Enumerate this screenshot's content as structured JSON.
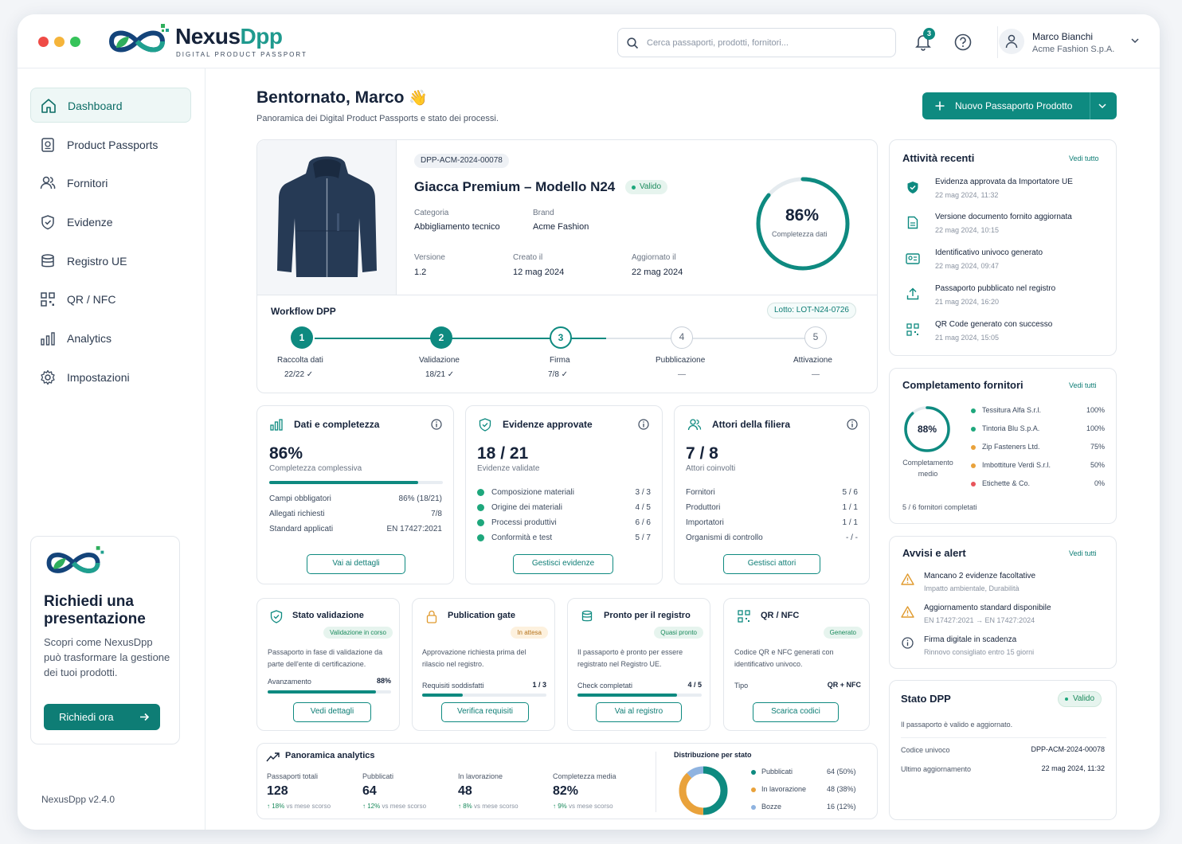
{
  "app": {
    "brand_a": "Nexus",
    "brand_b": "Dpp",
    "brand_sub": "DIGITAL PRODUCT PASSPORT",
    "version": "NexusDpp v2.4.0"
  },
  "topbar": {
    "search_placeholder": "Cerca passaporti, prodotti, fornitori...",
    "notification_count": "3",
    "user_name": "Marco Bianchi",
    "user_company": "Acme Fashion S.p.A."
  },
  "sidebar": {
    "items": [
      {
        "label": "Dashboard",
        "icon": "home-icon"
      },
      {
        "label": "Product Passports",
        "icon": "passport-icon"
      },
      {
        "label": "Fornitori",
        "icon": "users-icon"
      },
      {
        "label": "Evidenze",
        "icon": "shield-icon"
      },
      {
        "label": "Registro UE",
        "icon": "database-icon"
      },
      {
        "label": "QR / NFC",
        "icon": "qr-icon"
      },
      {
        "label": "Analytics",
        "icon": "bar-chart-icon"
      },
      {
        "label": "Impostazioni",
        "icon": "gear-icon"
      }
    ],
    "promo": {
      "title": "Richiedi una presentazione",
      "text": "Scopri come NexusDpp può trasformare la gestione dei tuoi prodotti.",
      "button": "Richiedi ora"
    }
  },
  "header": {
    "greeting": "Bentornato, Marco",
    "subtitle": "Panoramica dei Digital Product Passports e stato dei processi.",
    "new_button": "Nuovo Passaporto Prodotto"
  },
  "product": {
    "id": "DPP-ACM-2024-00078",
    "name": "Giacca Premium – Modello N24",
    "status": "Valido",
    "category_label": "Categoria",
    "category": "Abbigliamento tecnico",
    "brand_label": "Brand",
    "brand": "Acme Fashion",
    "version_label": "Versione",
    "version": "1.2",
    "created_label": "Creato il",
    "created": "12 mag 2024",
    "updated_label": "Aggiornato il",
    "updated": "22 mag 2024",
    "completeness": "86%",
    "completeness_value": 0.86,
    "completeness_label": "Completezza dati"
  },
  "workflow": {
    "title": "Workflow DPP",
    "lot": "Lotto: LOT-N24-0726",
    "steps": [
      {
        "n": "1",
        "label": "Raccolta dati",
        "sub": "22/22 ✓"
      },
      {
        "n": "2",
        "label": "Validazione",
        "sub": "18/21 ✓"
      },
      {
        "n": "3",
        "label": "Firma",
        "sub": "7/8 ✓"
      },
      {
        "n": "4",
        "label": "Pubblicazione",
        "sub": "—"
      },
      {
        "n": "5",
        "label": "Attivazione",
        "sub": "—"
      }
    ]
  },
  "cards": {
    "dati": {
      "title": "Dati e completezza",
      "value": "86%",
      "sub": "Completezza complessiva",
      "progress": 0.86,
      "rows": [
        [
          "Campi obbligatori",
          "86% (18/21)"
        ],
        [
          "Allegati richiesti",
          "7/8"
        ],
        [
          "Standard applicati",
          "EN 17427:2021"
        ]
      ],
      "button": "Vai ai dettagli"
    },
    "evidenze": {
      "title": "Evidenze approvate",
      "value": "18 / 21",
      "sub": "Evidenze validate",
      "rows": [
        [
          "Composizione materiali",
          "3 / 3"
        ],
        [
          "Origine dei materiali",
          "4 / 5"
        ],
        [
          "Processi produttivi",
          "6 / 6"
        ],
        [
          "Conformità e test",
          "5 / 7"
        ]
      ],
      "button": "Gestisci evidenze"
    },
    "attori": {
      "title": "Attori della filiera",
      "value": "7 / 8",
      "sub": "Attori coinvolti",
      "rows": [
        [
          "Fornitori",
          "5 / 6"
        ],
        [
          "Produttori",
          "1 / 1"
        ],
        [
          "Importatori",
          "1 / 1"
        ],
        [
          "Organismi di controllo",
          "- / -"
        ]
      ],
      "button": "Gestisci attori"
    }
  },
  "status_cards": [
    {
      "title": "Stato validazione",
      "pill": "Validazione in corso",
      "text": "Passaporto in fase di validazione da parte dell'ente di certificazione.",
      "k": "Avanzamento",
      "val": "88%",
      "progress": 0.88,
      "button": "Vedi dettagli"
    },
    {
      "title": "Publication gate",
      "pill": "In attesa",
      "text": "Approvazione richiesta prima del rilascio nel registro.",
      "k": "Requisiti soddisfatti",
      "val": "1 / 3",
      "progress": 0.33,
      "button": "Verifica requisiti"
    },
    {
      "title": "Pronto per il registro",
      "pill": "Quasi pronto",
      "text": "Il passaporto è pronto per essere registrato nel Registro UE.",
      "k": "Check completati",
      "val": "4 / 5",
      "progress": 0.8,
      "button": "Vai al registro"
    },
    {
      "title": "QR / NFC",
      "pill": "Generato",
      "text": "Codice QR e NFC generati con identificativo univoco.",
      "k": "Tipo",
      "val": "QR + NFC",
      "button": "Scarica codici"
    }
  ],
  "analytics": {
    "title": "Panoramica analytics",
    "kpis": [
      {
        "label": "Passaporti totali",
        "value": "128",
        "delta": "↑ 18%",
        "note": "vs mese scorso"
      },
      {
        "label": "Pubblicati",
        "value": "64",
        "delta": "↑ 12%",
        "note": "vs mese scorso"
      },
      {
        "label": "In lavorazione",
        "value": "48",
        "delta": "↑ 8%",
        "note": "vs mese scorso"
      },
      {
        "label": "Completezza media",
        "value": "82%",
        "delta": "↑ 9%",
        "note": "vs mese scorso"
      }
    ],
    "dist_title": "Distribuzione per stato",
    "dist": [
      {
        "label": "Pubblicati",
        "value": "64",
        "pct": "(50%)",
        "frac": 0.5,
        "color": "#0e8a80"
      },
      {
        "label": "In lavorazione",
        "value": "48",
        "pct": "(38%)",
        "frac": 0.38,
        "color": "#e9a23b"
      },
      {
        "label": "Bozze",
        "value": "16",
        "pct": "(12%)",
        "frac": 0.12,
        "color": "#8fb3e0"
      }
    ]
  },
  "activity": {
    "title": "Attività recenti",
    "link": "Vedi tutto",
    "items": [
      {
        "text": "Evidenza approvata da Importatore UE",
        "time": "22 mag 2024, 11:32",
        "icon": "shield-check-icon"
      },
      {
        "text": "Versione documento fornito aggiornata",
        "time": "22 mag 2024, 10:15",
        "icon": "document-icon"
      },
      {
        "text": "Identificativo univoco generato",
        "time": "22 mag 2024, 09:47",
        "icon": "id-card-icon"
      },
      {
        "text": "Passaporto pubblicato nel registro",
        "time": "21 mag 2024, 16:20",
        "icon": "upload-icon"
      },
      {
        "text": "QR Code generato con successo",
        "time": "21 mag 2024, 15:05",
        "icon": "qr-icon"
      }
    ]
  },
  "suppliers": {
    "title": "Completamento fornitori",
    "link": "Vedi tutti",
    "avg": "88%",
    "avg_value": 0.88,
    "avg_label": "Completamento medio",
    "items": [
      {
        "name": "Tessitura Alfa S.r.l.",
        "pct": "100%",
        "color": "#1ea77c"
      },
      {
        "name": "Tintoria Blu S.p.A.",
        "pct": "100%",
        "color": "#1ea77c"
      },
      {
        "name": "Zip Fasteners Ltd.",
        "pct": "75%",
        "color": "#e9a23b"
      },
      {
        "name": "Imbottiture Verdi S.r.l.",
        "pct": "50%",
        "color": "#e9a23b"
      },
      {
        "name": "Etichette & Co.",
        "pct": "0%",
        "color": "#e8555b"
      }
    ],
    "footer": "5 / 6 fornitori completati"
  },
  "alerts": {
    "title": "Avvisi e alert",
    "link": "Vedi tutti",
    "items": [
      {
        "title": "Mancano 2 evidenze facoltative",
        "sub": "Impatto ambientale, Durabilità",
        "icon": "warning-icon"
      },
      {
        "title": "Aggiornamento standard disponibile",
        "sub": "EN 17427:2021 → EN 17427:2024",
        "icon": "warning-icon"
      },
      {
        "title": "Firma digitale in scadenza",
        "sub": "Rinnovo consigliato entro 15 giorni",
        "icon": "info-icon"
      }
    ]
  },
  "dpp_state": {
    "title": "Stato DPP",
    "status": "Valido",
    "text": "Il passaporto è valido e aggiornato.",
    "k1": "Codice univoco",
    "v1": "DPP-ACM-2024-00078",
    "k2": "Ultimo aggiornamento",
    "v2": "22 mag 2024, 11:32"
  }
}
